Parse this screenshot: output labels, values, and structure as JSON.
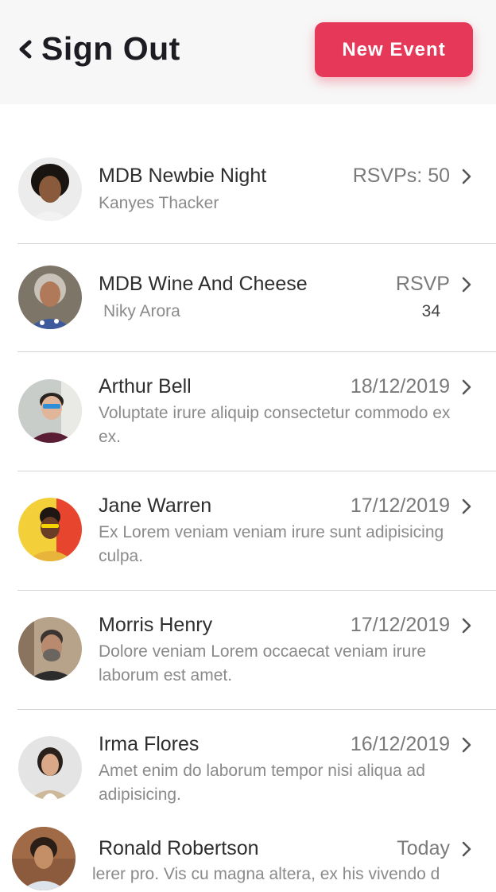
{
  "header": {
    "back_label": "Sign Out",
    "new_event_label": "New Event",
    "accent_color": "#e6395a"
  },
  "events": [
    {
      "title": "MDB Newbie Night",
      "subtitle": "Kanyes Thacker",
      "meta": "RSVPs: 50"
    },
    {
      "title": "MDB Wine And Cheese",
      "subtitle": "Niky Arora",
      "meta": "RSVP",
      "meta_count": "34"
    },
    {
      "title": "Arthur Bell",
      "subtitle": "Voluptate irure aliquip consectetur commodo ex ex.",
      "meta": "18/12/2019"
    },
    {
      "title": "Jane Warren",
      "subtitle": "Ex Lorem veniam veniam irure sunt adipisicing culpa.",
      "meta": "17/12/2019"
    },
    {
      "title": "Morris Henry",
      "subtitle": "Dolore veniam Lorem occaecat veniam irure laborum est amet.",
      "meta": "17/12/2019"
    },
    {
      "title": "Irma Flores",
      "subtitle": "Amet enim do laborum tempor nisi aliqua ad adipisicing.",
      "meta": "16/12/2019"
    },
    {
      "title": "Ronald Robertson",
      "subtitle": "lerer pro. Vis cu magna altera, ex his vivendo d",
      "meta": "Today"
    }
  ]
}
